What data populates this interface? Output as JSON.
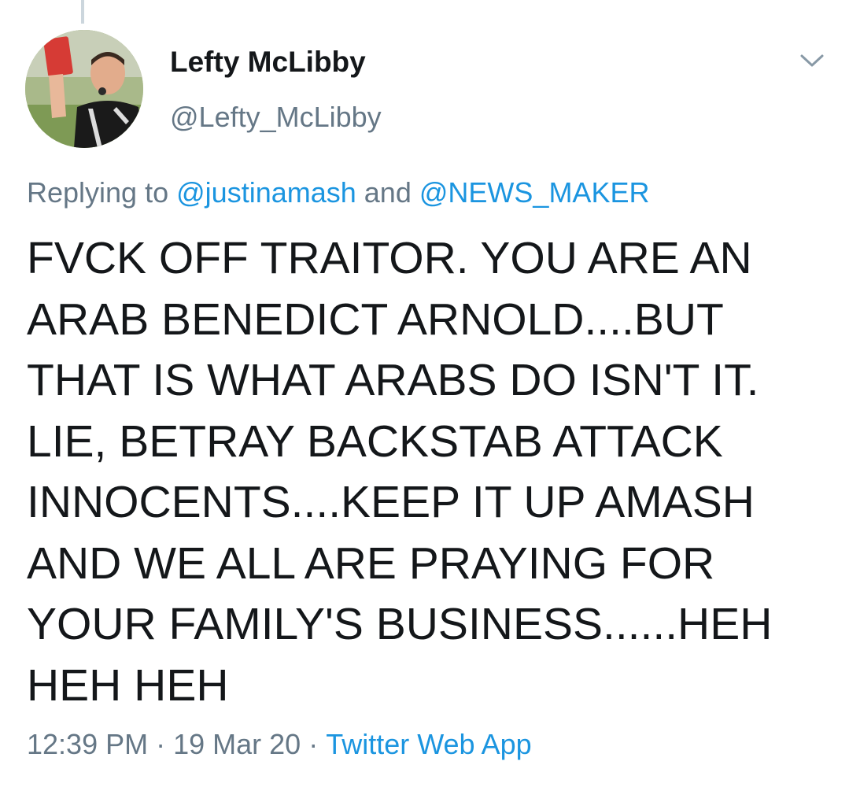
{
  "tweet": {
    "display_name": "Lefty McLibby",
    "handle": "@Lefty_McLibby",
    "reply": {
      "prefix": "Replying to",
      "mention_1": "@justinamash",
      "conjunction": "and",
      "mention_2": "@NEWS_MAKER"
    },
    "body_lines": [
      "FVCK OFF TRAITOR. YOU ARE AN",
      "ARAB BENEDICT ARNOLD....BUT",
      "THAT IS WHAT ARABS DO ISN'T IT.",
      "LIE, BETRAY BACKSTAB ATTACK",
      "INNOCENTS....KEEP IT UP AMASH",
      "AND WE ALL ARE PRAYING FOR",
      "YOUR FAMILY'S BUSINESS......HEH",
      "HEH HEH"
    ],
    "time": "12:39 PM",
    "date": "19 Mar 20",
    "separator": "·",
    "source": "Twitter Web App",
    "icons": {
      "avatar": "avatar-referee-red-card",
      "menu": "chevron-down-icon"
    }
  },
  "colors": {
    "text": "#14171a",
    "secondary": "#657786",
    "link": "#1b95e0",
    "thread_line": "#ccd6dd"
  }
}
